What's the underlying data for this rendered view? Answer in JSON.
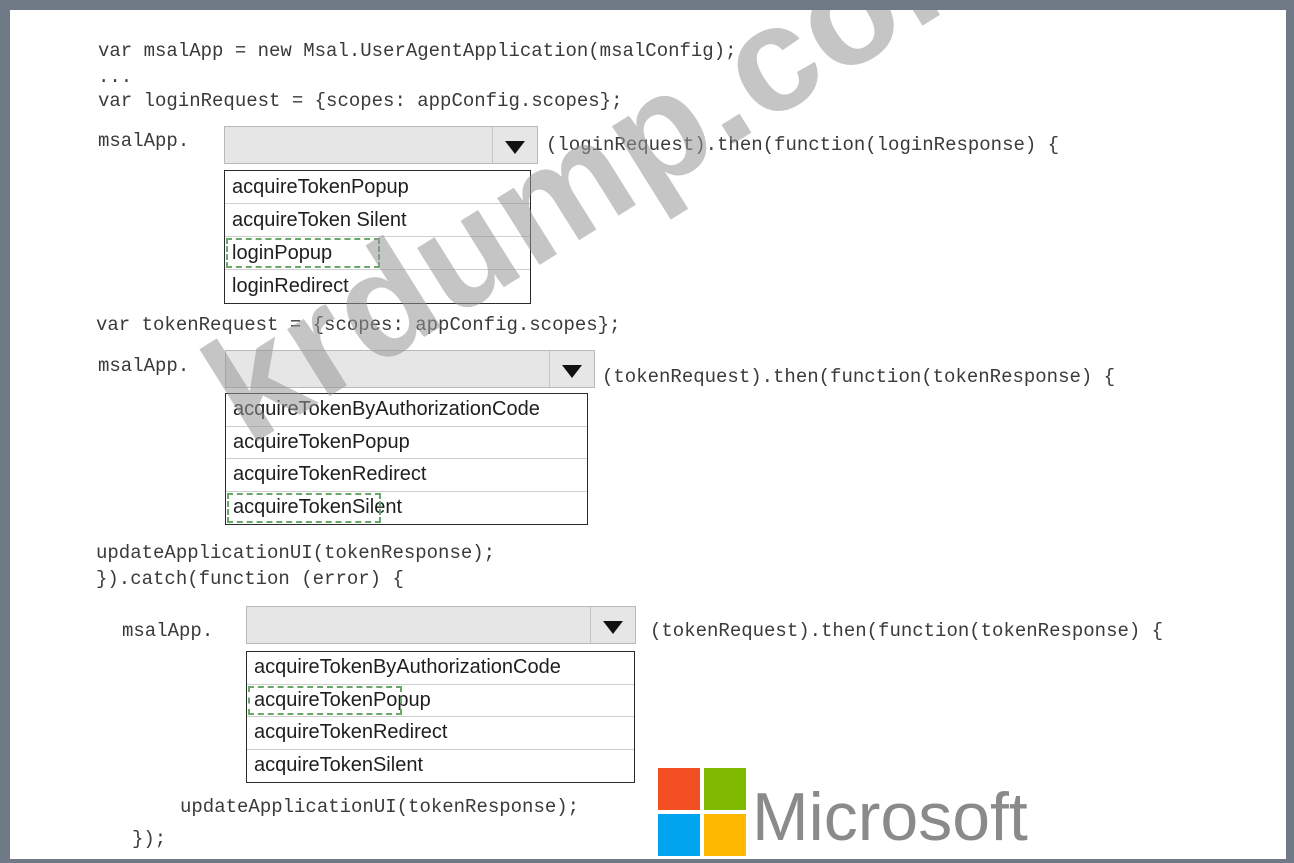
{
  "code_lines": {
    "l1": "var msalApp = new Msal.UserAgentApplication(msalConfig);",
    "l2": "...",
    "l3": "var loginRequest = {scopes: appConfig.scopes};",
    "l4_prefix": "msalApp.",
    "l4_suffix": "(loginRequest).then(function(loginResponse) {",
    "l5": "var tokenRequest = {scopes: appConfig.scopes};",
    "l6_prefix": "msalApp.",
    "l6_suffix": "(tokenRequest).then(function(tokenResponse) {",
    "l7": "updateApplicationUI(tokenResponse);",
    "l8": "}).catch(function (error) {",
    "l9_prefix": "msalApp.",
    "l9_suffix": "(tokenRequest).then(function(tokenResponse) {",
    "l10": "updateApplicationUI(tokenResponse);",
    "l11": "});"
  },
  "dropdown1": {
    "options": [
      "acquireTokenPopup",
      "acquireToken Silent",
      "loginPopup",
      "loginRedirect"
    ],
    "selected": "loginPopup"
  },
  "dropdown2": {
    "options": [
      "acquireTokenByAuthorizationCode",
      "acquireTokenPopup",
      "acquireTokenRedirect",
      "acquireTokenSilent"
    ],
    "selected": "acquireTokenSilent"
  },
  "dropdown3": {
    "options": [
      "acquireTokenByAuthorizationCode",
      "acquireTokenPopup",
      "acquireTokenRedirect",
      "acquireTokenSilent"
    ],
    "selected": "acquireTokenPopup"
  },
  "watermark": "krdump.com",
  "logo": {
    "text": "Microsoft",
    "colors": [
      "#f25022",
      "#7fba00",
      "#00a4ef",
      "#ffb900"
    ]
  }
}
